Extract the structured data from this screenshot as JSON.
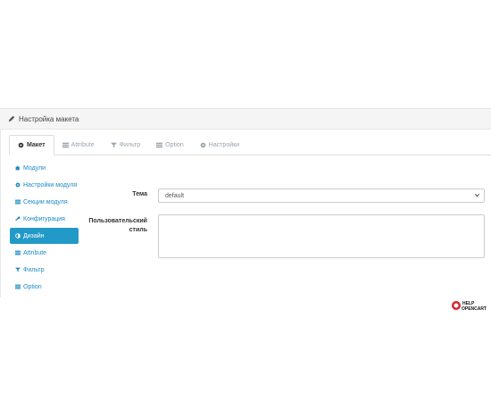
{
  "panel": {
    "title": "Настройка макета",
    "title_icon": "pencil-icon"
  },
  "tabs": [
    {
      "label": "Макет",
      "icon": "gear-icon",
      "active": true
    },
    {
      "label": "Attribute",
      "icon": "list-icon",
      "active": false
    },
    {
      "label": "Фильтр",
      "icon": "filter-icon",
      "active": false
    },
    {
      "label": "Option",
      "icon": "list-icon",
      "active": false
    },
    {
      "label": "Настройки",
      "icon": "gear-icon",
      "active": false
    }
  ],
  "sidenav": [
    {
      "label": "Модули",
      "icon": "puzzle-icon",
      "active": false
    },
    {
      "label": "Настройки модуля",
      "icon": "gear-icon",
      "active": false
    },
    {
      "label": "Секции модуля",
      "icon": "list-icon",
      "active": false
    },
    {
      "label": "Конфигурация",
      "icon": "wrench-icon",
      "active": false
    },
    {
      "label": "Дизайн",
      "icon": "adjust-icon",
      "active": true
    },
    {
      "label": "Attribute",
      "icon": "list-icon",
      "active": false
    },
    {
      "label": "Фильтр",
      "icon": "filter-icon",
      "active": false
    },
    {
      "label": "Option",
      "icon": "list-icon",
      "active": false
    }
  ],
  "form": {
    "theme_label": "Тема",
    "theme_value": "default",
    "style_label_line1": "Пользовательский",
    "style_label_line2": "стиль",
    "style_value": ""
  },
  "colors": {
    "accent": "#229ac8",
    "link": "#1e8bc3"
  }
}
